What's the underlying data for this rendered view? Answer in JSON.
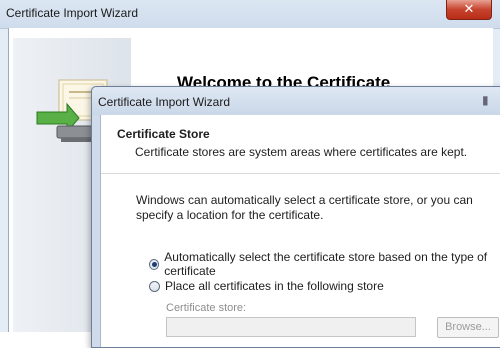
{
  "back_window": {
    "title": "Certificate Import Wizard",
    "close_label": "✕",
    "heading": "Welcome to the Certificate Import Wizard"
  },
  "front_window": {
    "title": "Certificate Import Wizard",
    "section_title": "Certificate Store",
    "section_subtitle": "Certificate stores are system areas where certificates are kept.",
    "intro": "Windows can automatically select a certificate store, or you can specify a location for the certificate.",
    "options": [
      {
        "label": "Automatically select the certificate store based on the type of certificate",
        "selected": true
      },
      {
        "label": "Place all certificates in the following store",
        "selected": false
      }
    ],
    "store_label": "Certificate store:",
    "store_value": "",
    "browse_label": "Browse..."
  },
  "colors": {
    "close_button": "#c7432e",
    "window_frame": "#cfdbea"
  },
  "icons": [
    "certificate-import-icon",
    "close-icon",
    "radio-selected-icon"
  ]
}
